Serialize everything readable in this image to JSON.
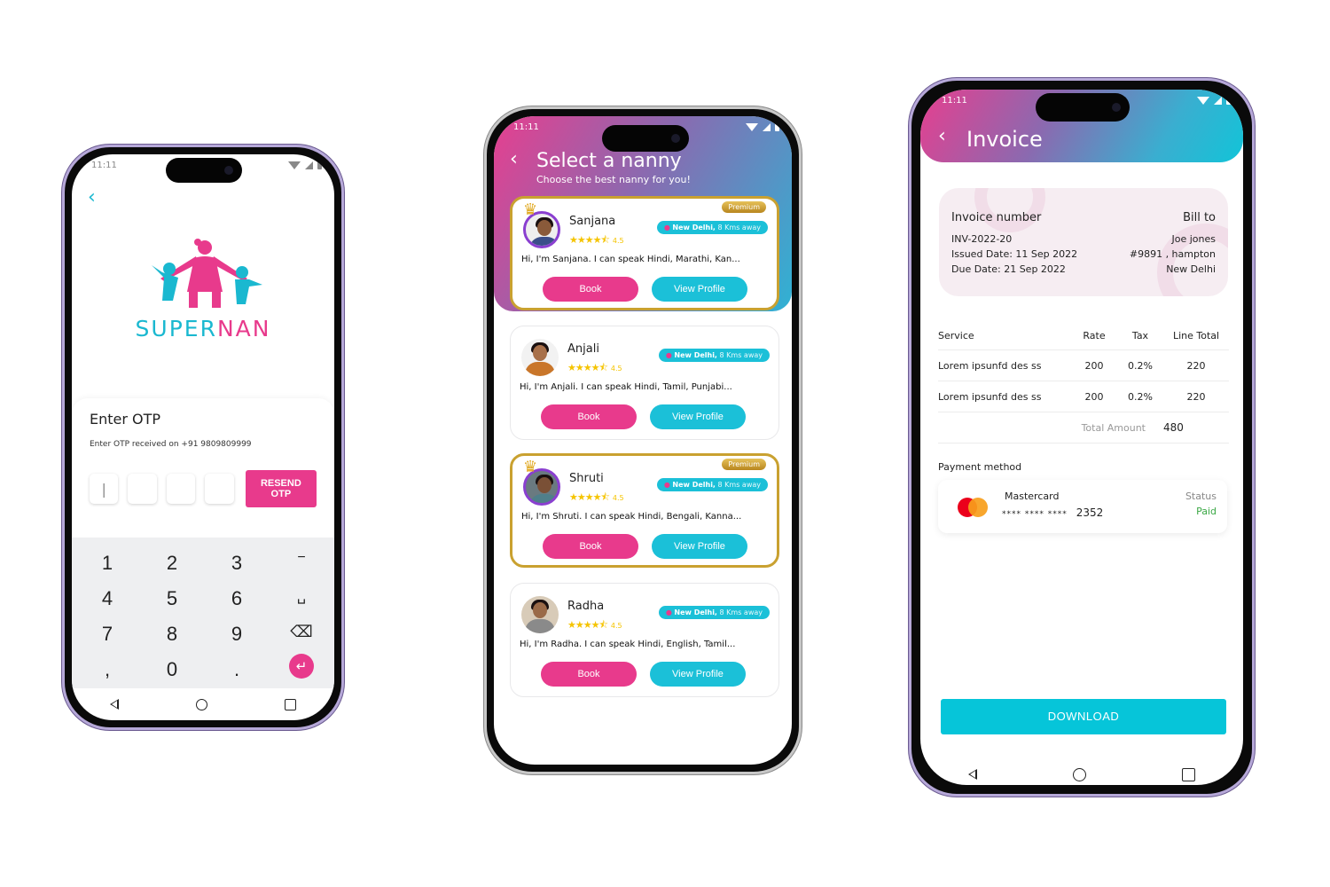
{
  "status_bar": {
    "time": "11:11"
  },
  "otp_screen": {
    "brand_part1": "SUPER",
    "brand_part2": "NAN",
    "title": "Enter OTP",
    "subtitle": "Enter OTP received on +91 9809809999",
    "otp_values": [
      "|",
      "",
      "",
      ""
    ],
    "resend_label": "RESEND OTP",
    "keypad": {
      "rows": [
        [
          "1",
          "2",
          "3",
          "−"
        ],
        [
          "4",
          "5",
          "6",
          "␣"
        ],
        [
          "7",
          "8",
          "9",
          "⌫"
        ],
        [
          ",",
          "0",
          ".",
          "↵"
        ]
      ]
    }
  },
  "nanny_screen": {
    "title": "Select a nanny",
    "subtitle": "Choose the best nanny for you!",
    "premium_label": "Premium",
    "book_label": "Book",
    "view_label": "View Profile",
    "nannies": [
      {
        "name": "Sanjana",
        "rating": "4.5",
        "city": "New Delhi,",
        "distance": "8 Kms away",
        "description": "Hi, I'm Sanjana. I can speak Hindi, Marathi, Kan...",
        "premium": true
      },
      {
        "name": "Anjali",
        "rating": "4.5",
        "city": "New Delhi,",
        "distance": "8 Kms away",
        "description": "Hi, I'm Anjali. I can speak Hindi, Tamil, Punjabi...",
        "premium": false
      },
      {
        "name": "Shruti",
        "rating": "4.5",
        "city": "New Delhi,",
        "distance": "8 Kms away",
        "description": "Hi, I'm Shruti. I can speak Hindi, Bengali, Kanna...",
        "premium": true
      },
      {
        "name": "Radha",
        "rating": "4.5",
        "city": "New Delhi,",
        "distance": "8 Kms away",
        "description": "Hi, I'm Radha. I can speak Hindi, English, Tamil...",
        "premium": false
      }
    ]
  },
  "invoice_screen": {
    "title": "Invoice",
    "invoice_label": "Invoice number",
    "invoice_number": "INV-2022-20",
    "issued_date": "Issued Date: 11 Sep 2022",
    "due_date": "Due Date: 21 Sep 2022",
    "bill_to_label": "Bill to",
    "bill_name": "Joe jones",
    "bill_address": "#9891 , hampton",
    "bill_city": "New Delhi",
    "table": {
      "headers": [
        "Service",
        "Rate",
        "Tax",
        "Line Total"
      ],
      "rows": [
        [
          "Lorem ipsunfd des ss",
          "200",
          "0.2%",
          "220"
        ],
        [
          "Lorem ipsunfd des ss",
          "200",
          "0.2%",
          "220"
        ]
      ],
      "total_label": "Total Amount",
      "total_value": "480"
    },
    "payment_title": "Payment method",
    "card_brand": "Mastercard",
    "card_mask": "****  ****  ****",
    "card_last4": "2352",
    "status_label": "Status",
    "status_value": "Paid",
    "download_label": "DOWNLOAD"
  },
  "colors": {
    "pink": "#e83a8c",
    "cyan": "#1bc0d8",
    "gold": "#c9a130",
    "paid_green": "#3aa845"
  }
}
